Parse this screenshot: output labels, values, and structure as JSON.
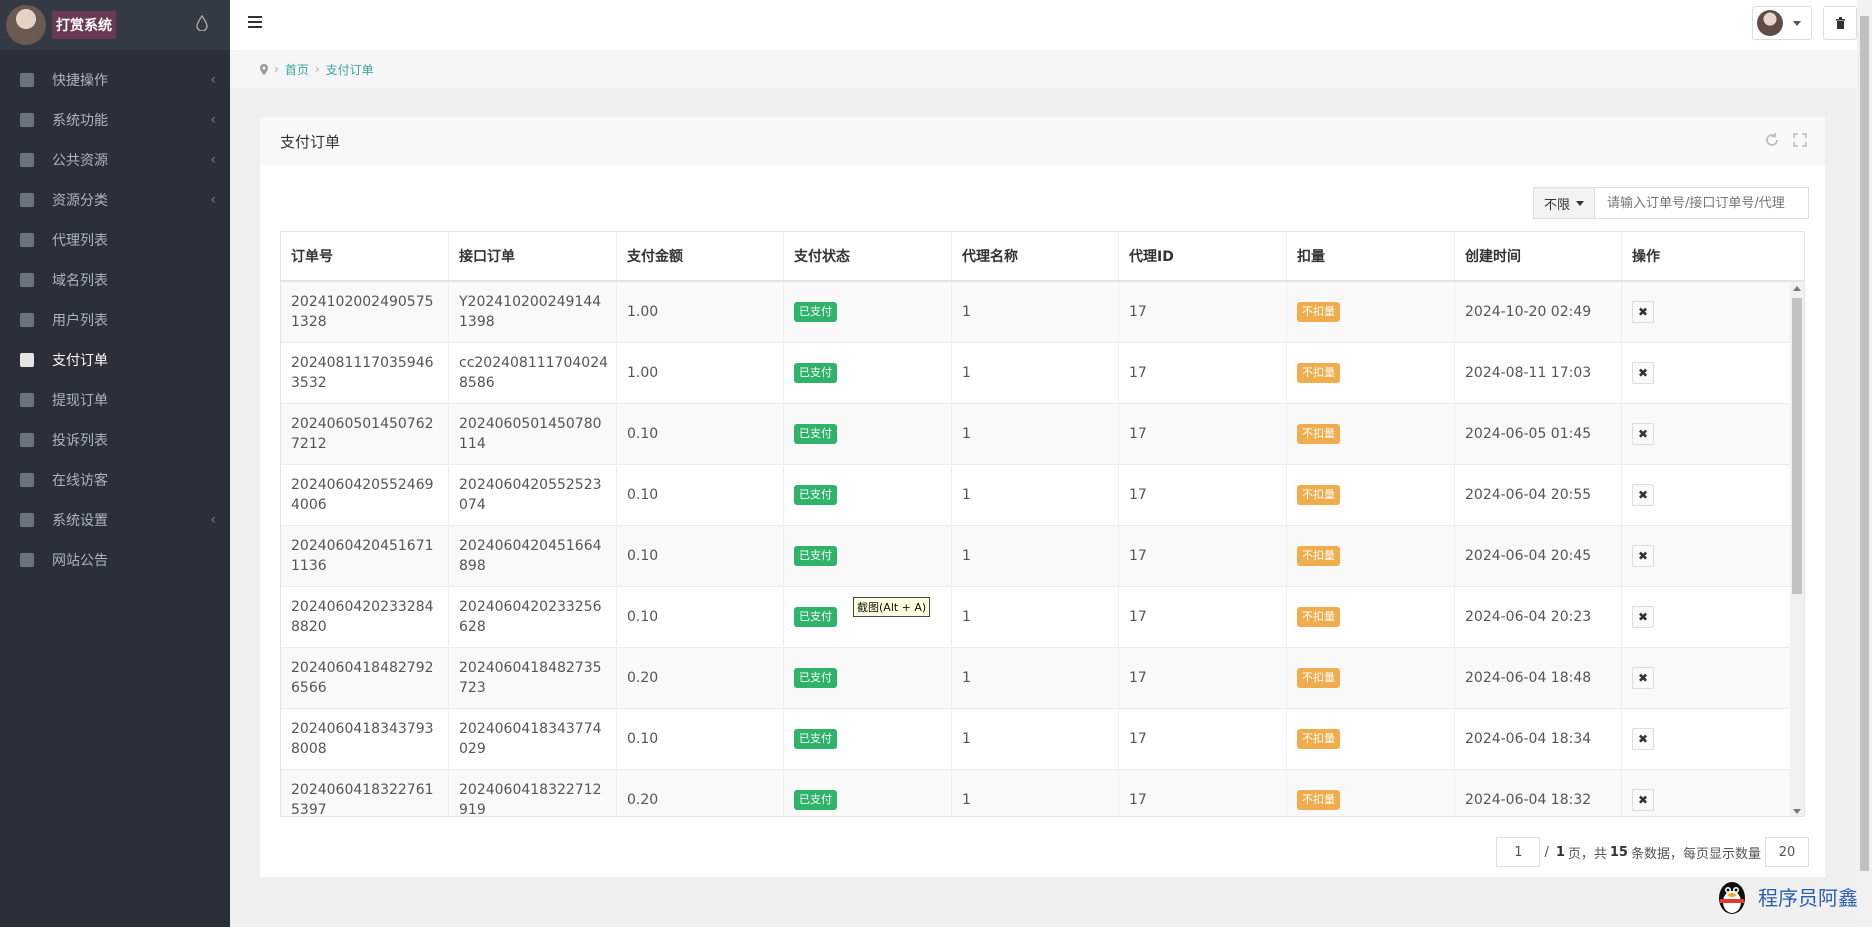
{
  "brand": {
    "title": "打赏系统"
  },
  "sidebar": {
    "items": [
      {
        "label": "快捷操作",
        "icon": "folder-icon",
        "arrow": true,
        "active": false
      },
      {
        "label": "系统功能",
        "icon": "wrench-icon",
        "arrow": true,
        "active": false
      },
      {
        "label": "公共资源",
        "icon": "video-icon",
        "arrow": true,
        "active": false
      },
      {
        "label": "资源分类",
        "icon": "grid-icon",
        "arrow": true,
        "active": false
      },
      {
        "label": "代理列表",
        "icon": "users-icon",
        "arrow": false,
        "active": false
      },
      {
        "label": "域名列表",
        "icon": "linkedin-icon",
        "arrow": false,
        "active": false
      },
      {
        "label": "用户列表",
        "icon": "user-icon",
        "arrow": false,
        "active": false
      },
      {
        "label": "支付订单",
        "icon": "database-icon",
        "arrow": false,
        "active": true
      },
      {
        "label": "提现订单",
        "icon": "bank-icon",
        "arrow": false,
        "active": false
      },
      {
        "label": "投诉列表",
        "icon": "alert-icon",
        "arrow": false,
        "active": false
      },
      {
        "label": "在线访客",
        "icon": "ie-icon",
        "arrow": false,
        "active": false
      },
      {
        "label": "系统设置",
        "icon": "gear-icon",
        "arrow": true,
        "active": false
      },
      {
        "label": "网站公告",
        "icon": "bullhorn-icon",
        "arrow": false,
        "active": false
      }
    ],
    "arrow_glyph": "‹"
  },
  "breadcrumb": {
    "home": "首页",
    "current": "支付订单"
  },
  "panel": {
    "title": "支付订单"
  },
  "toolbar": {
    "filter_label": "不限",
    "search_placeholder": "请输入订单号/接口订单号/代理"
  },
  "table": {
    "headers": [
      "订单号",
      "接口订单",
      "支付金额",
      "支付状态",
      "代理名称",
      "代理ID",
      "扣量",
      "创建时间",
      "操作"
    ],
    "rows": [
      {
        "order": "20241020024905751328",
        "iface": "Y2024102002491441398",
        "amount": "1.00",
        "status": "已支付",
        "agent": "1",
        "agent_id": "17",
        "deduct": "不扣量",
        "created": "2024-10-20 02:49"
      },
      {
        "order": "20240811170359463532",
        "iface": "cc2024081117040248586",
        "amount": "1.00",
        "status": "已支付",
        "agent": "1",
        "agent_id": "17",
        "deduct": "不扣量",
        "created": "2024-08-11 17:03"
      },
      {
        "order": "20240605014507627212",
        "iface": "2024060501450780114",
        "amount": "0.10",
        "status": "已支付",
        "agent": "1",
        "agent_id": "17",
        "deduct": "不扣量",
        "created": "2024-06-05 01:45"
      },
      {
        "order": "20240604205524694006",
        "iface": "2024060420552523074",
        "amount": "0.10",
        "status": "已支付",
        "agent": "1",
        "agent_id": "17",
        "deduct": "不扣量",
        "created": "2024-06-04 20:55"
      },
      {
        "order": "20240604204516711136",
        "iface": "2024060420451664898",
        "amount": "0.10",
        "status": "已支付",
        "agent": "1",
        "agent_id": "17",
        "deduct": "不扣量",
        "created": "2024-06-04 20:45"
      },
      {
        "order": "20240604202332848820",
        "iface": "2024060420233256628",
        "amount": "0.10",
        "status": "已支付",
        "agent": "1",
        "agent_id": "17",
        "deduct": "不扣量",
        "created": "2024-06-04 20:23"
      },
      {
        "order": "20240604184827926566",
        "iface": "2024060418482735723",
        "amount": "0.20",
        "status": "已支付",
        "agent": "1",
        "agent_id": "17",
        "deduct": "不扣量",
        "created": "2024-06-04 18:48"
      },
      {
        "order": "20240604183437938008",
        "iface": "2024060418343774029",
        "amount": "0.10",
        "status": "已支付",
        "agent": "1",
        "agent_id": "17",
        "deduct": "不扣量",
        "created": "2024-06-04 18:34"
      },
      {
        "order": "20240604183227615397",
        "iface": "2024060418322712919",
        "amount": "0.20",
        "status": "已支付",
        "agent": "1",
        "agent_id": "17",
        "deduct": "不扣量",
        "created": "2024-06-04 18:32"
      }
    ],
    "delete_glyph": "✖"
  },
  "tooltip": {
    "text": "截图(Alt + A)"
  },
  "pager": {
    "current": "1",
    "total_pages": "1",
    "page_label": "页，共",
    "total_records": "15",
    "records_label": "条数据，每页显示数量",
    "page_size": "20",
    "slash": "/"
  },
  "watermark": {
    "text": "程序员阿鑫"
  },
  "colors": {
    "sidebar_bg": "#2b3038",
    "accent": "#3aa5a0",
    "paid_badge": "#2fb36b",
    "deduct_badge": "#f0ad4e"
  }
}
